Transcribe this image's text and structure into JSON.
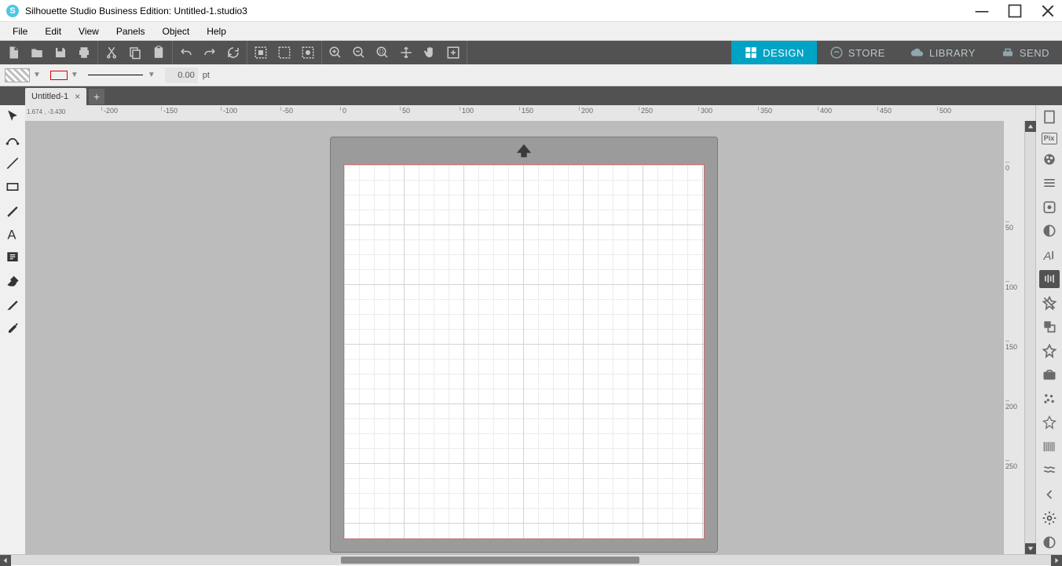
{
  "app": {
    "title": "Silhouette Studio Business Edition: Untitled-1.studio3",
    "icon_letter": "S"
  },
  "menu": [
    "File",
    "Edit",
    "View",
    "Panels",
    "Object",
    "Help"
  ],
  "nav_tabs": [
    {
      "label": "DESIGN",
      "active": true
    },
    {
      "label": "STORE",
      "active": false
    },
    {
      "label": "LIBRARY",
      "active": false
    },
    {
      "label": "SEND",
      "active": false
    }
  ],
  "stroke": {
    "weight": "0.00",
    "unit": "pt"
  },
  "document": {
    "tab_name": "Untitled-1"
  },
  "ruler": {
    "coord": "1.674 , -3.430",
    "h_ticks": [
      -200,
      -150,
      -100,
      -50,
      0,
      50,
      100,
      150,
      200,
      250,
      300,
      350,
      400,
      450,
      500
    ],
    "v_ticks": [
      0,
      50,
      100,
      150,
      200,
      250
    ]
  },
  "right_panel_pix": "Pix"
}
